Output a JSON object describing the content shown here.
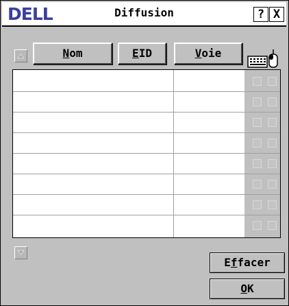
{
  "window": {
    "logo": "DELL",
    "title": "Diffusion",
    "help": "?",
    "close": "X"
  },
  "columns": {
    "name": {
      "pre": "",
      "ul": "N",
      "post": "om"
    },
    "eid": {
      "pre": "",
      "ul": "E",
      "post": "ID"
    },
    "port": {
      "pre": "",
      "ul": "V",
      "post": "oie"
    }
  },
  "rows": [
    {
      "name": "",
      "eid": "",
      "kbd": false,
      "mouse": false
    },
    {
      "name": "",
      "eid": "",
      "kbd": false,
      "mouse": false
    },
    {
      "name": "",
      "eid": "",
      "kbd": false,
      "mouse": false
    },
    {
      "name": "",
      "eid": "",
      "kbd": false,
      "mouse": false
    },
    {
      "name": "",
      "eid": "",
      "kbd": false,
      "mouse": false
    },
    {
      "name": "",
      "eid": "",
      "kbd": false,
      "mouse": false
    },
    {
      "name": "",
      "eid": "",
      "kbd": false,
      "mouse": false
    },
    {
      "name": "",
      "eid": "",
      "kbd": false,
      "mouse": false
    }
  ],
  "icons": {
    "keyboard": "keyboard-icon",
    "mouse": "mouse-icon"
  },
  "buttons": {
    "clear": {
      "pre": "E",
      "ul": "f",
      "post": "facer"
    },
    "ok": {
      "pre": "",
      "ul": "O",
      "post": "K"
    }
  }
}
